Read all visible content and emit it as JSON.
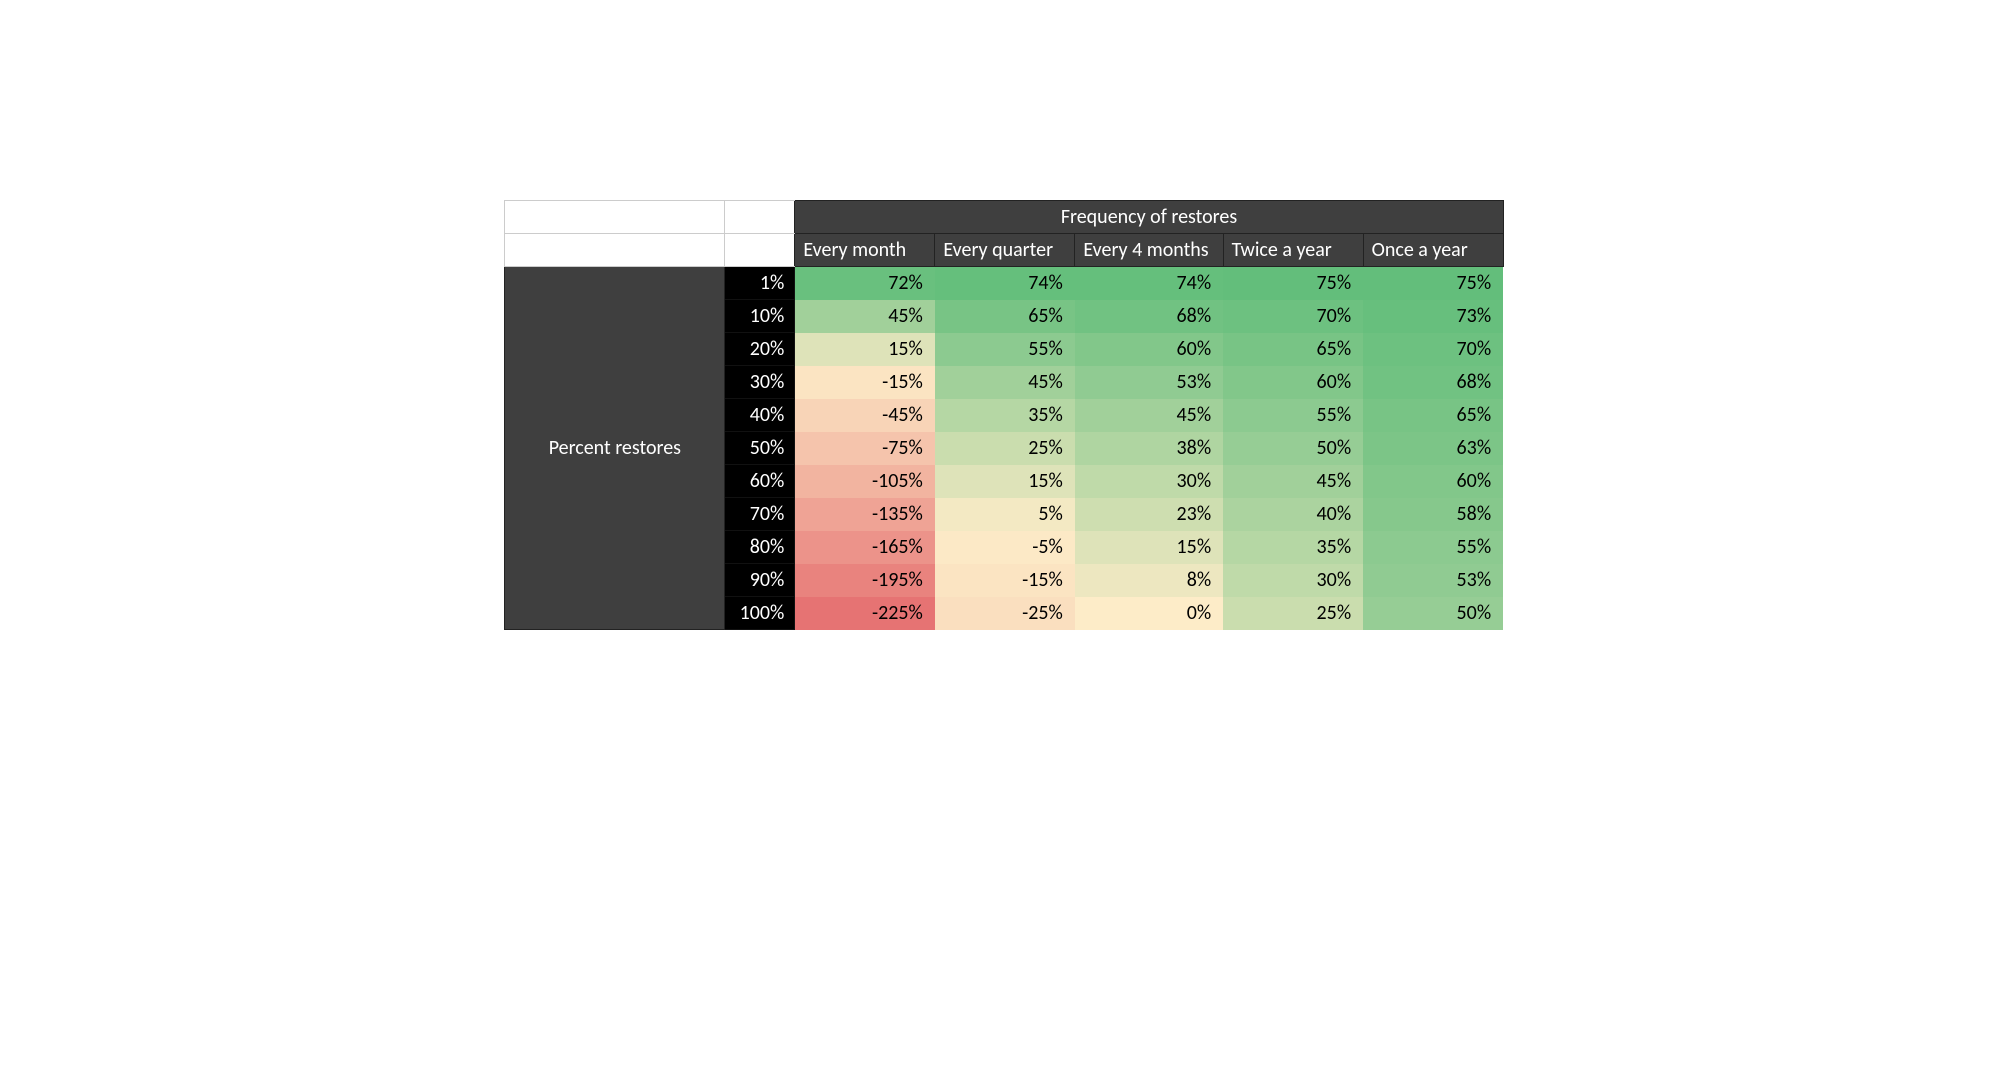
{
  "chart_data": {
    "type": "heatmap",
    "title": "Frequency of restores",
    "row_axis_label": "Percent restores",
    "columns": [
      "Every month",
      "Every quarter",
      "Every 4 months",
      "Twice a year",
      "Once a year"
    ],
    "rows": [
      "1%",
      "10%",
      "20%",
      "30%",
      "40%",
      "50%",
      "60%",
      "70%",
      "80%",
      "90%",
      "100%"
    ],
    "values": [
      [
        72,
        74,
        74,
        75,
        75
      ],
      [
        45,
        65,
        68,
        70,
        73
      ],
      [
        15,
        55,
        60,
        65,
        70
      ],
      [
        -15,
        45,
        53,
        60,
        68
      ],
      [
        -45,
        35,
        45,
        55,
        65
      ],
      [
        -75,
        25,
        38,
        50,
        63
      ],
      [
        -105,
        15,
        30,
        45,
        60
      ],
      [
        -135,
        5,
        23,
        40,
        58
      ],
      [
        -165,
        -5,
        15,
        35,
        55
      ],
      [
        -195,
        -15,
        8,
        30,
        53
      ],
      [
        -225,
        -25,
        0,
        25,
        50
      ]
    ],
    "value_suffix": "%",
    "color_scale": {
      "min": -225,
      "min_color": "#e67373",
      "mid": 0,
      "mid_color": "#fdecc8",
      "max": 75,
      "max_color": "#63be7b"
    }
  }
}
